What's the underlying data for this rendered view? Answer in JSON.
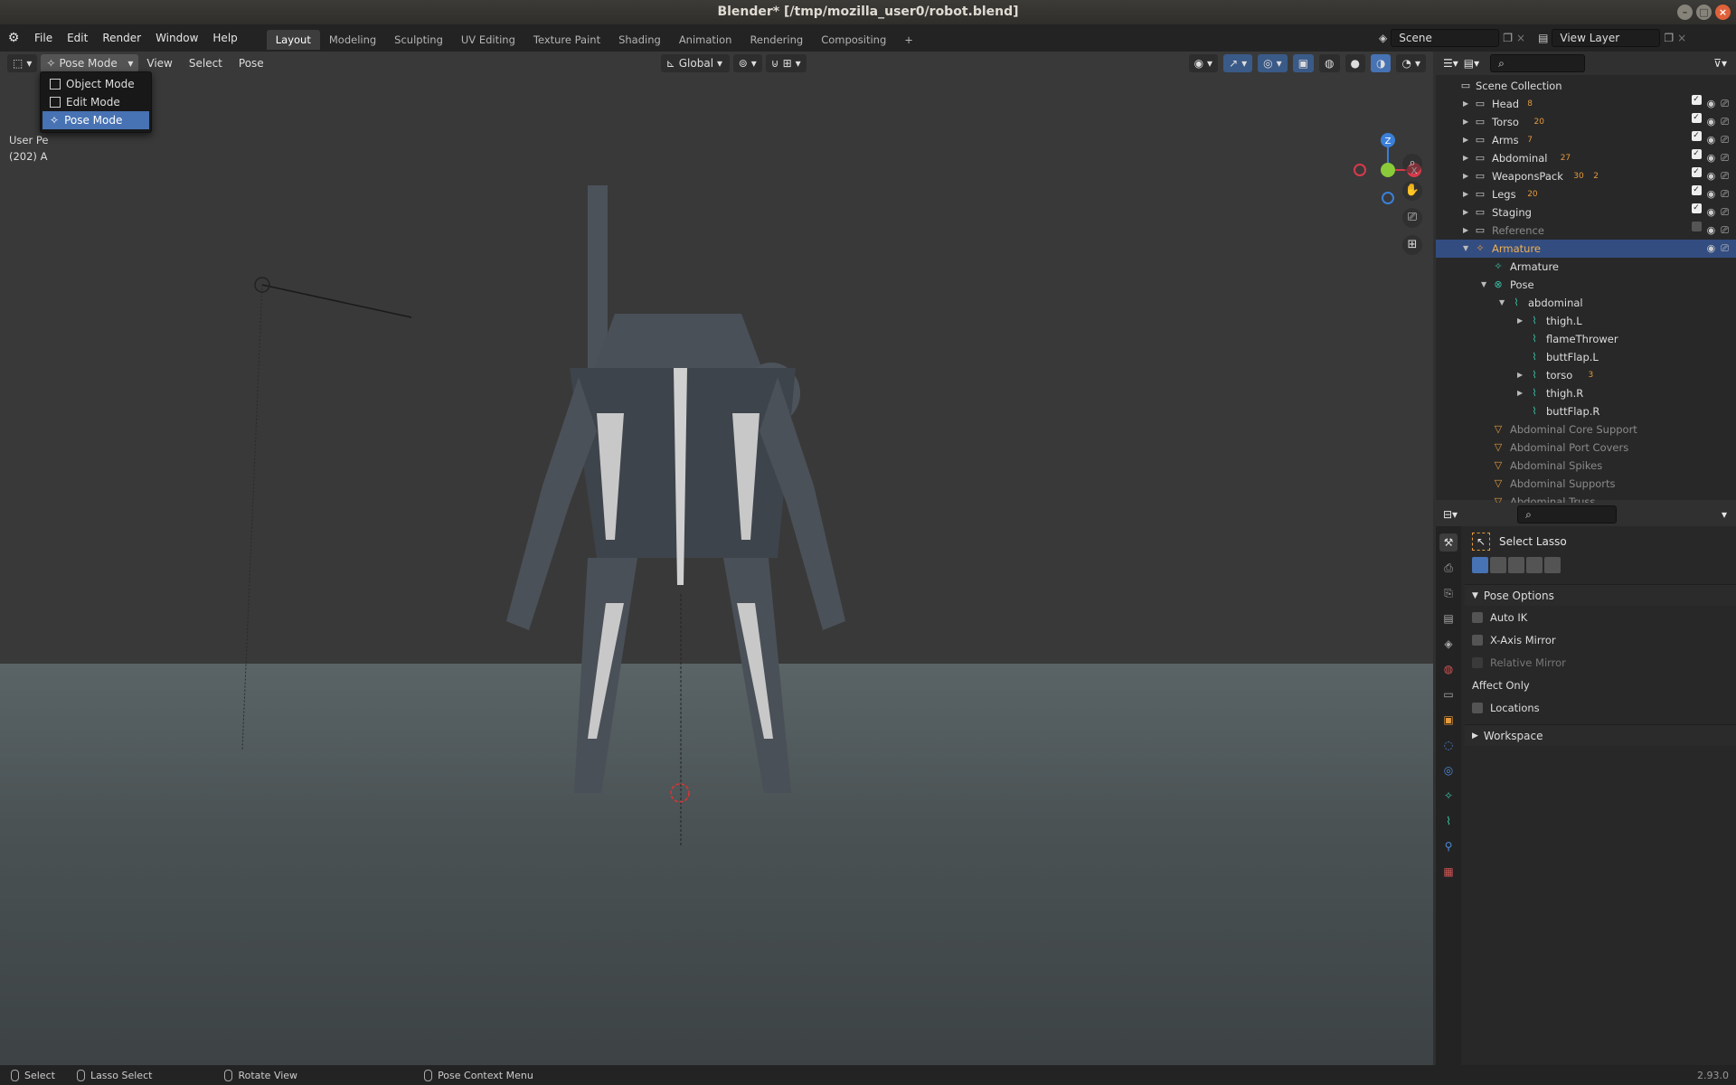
{
  "window": {
    "title": "Blender* [/tmp/mozilla_user0/robot.blend]"
  },
  "top_menu": [
    "File",
    "Edit",
    "Render",
    "Window",
    "Help"
  ],
  "workspaces": [
    "Layout",
    "Modeling",
    "Sculpting",
    "UV Editing",
    "Texture Paint",
    "Shading",
    "Animation",
    "Rendering",
    "Compositing"
  ],
  "active_workspace": "Layout",
  "scene": {
    "name": "Scene",
    "view_layer": "View Layer"
  },
  "viewport": {
    "mode_label": "Pose Mode",
    "menus": [
      "View",
      "Select",
      "Pose"
    ],
    "transform_orientation": "Global",
    "info_line1": "User Pe",
    "info_line2": "(202) A",
    "mode_dropdown": [
      "Object Mode",
      "Edit Mode",
      "Pose Mode"
    ],
    "selected_mode": "Pose Mode",
    "gizmo_axes": {
      "z": "Z",
      "y": "Y",
      "x": "X"
    }
  },
  "outliner": {
    "root": "Scene Collection",
    "rows": [
      {
        "label": "Head",
        "badge": "8",
        "dim": false,
        "selected": false
      },
      {
        "label": "Torso",
        "badge": "20",
        "dim": false,
        "selected": false
      },
      {
        "label": "Arms",
        "badge": "7",
        "dim": false,
        "selected": false
      },
      {
        "label": "Abdominal",
        "badge": "27",
        "dim": false,
        "selected": false
      },
      {
        "label": "WeaponsPack",
        "badge": "30",
        "badge2": "2",
        "dim": false,
        "selected": false
      },
      {
        "label": "Legs",
        "badge": "20",
        "dim": false,
        "selected": false
      },
      {
        "label": "Staging",
        "badge": "",
        "dim": false,
        "selected": false
      },
      {
        "label": "Reference",
        "badge": "",
        "dim": true,
        "selected": false
      },
      {
        "label": "Armature",
        "badge": "",
        "dim": false,
        "selected": true
      },
      {
        "label": "Armature",
        "badge": "",
        "dim": false,
        "selected": false
      },
      {
        "label": "Pose",
        "badge": "",
        "dim": false,
        "selected": false
      },
      {
        "label": "abdominal",
        "badge": "",
        "dim": false,
        "selected": false
      },
      {
        "label": "thigh.L",
        "badge": "",
        "dim": false,
        "selected": false
      },
      {
        "label": "flameThrower",
        "badge": "",
        "dim": false,
        "selected": false
      },
      {
        "label": "buttFlap.L",
        "badge": "",
        "dim": false,
        "selected": false
      },
      {
        "label": "torso",
        "badge": "3",
        "dim": false,
        "selected": false
      },
      {
        "label": "thigh.R",
        "badge": "",
        "dim": false,
        "selected": false
      },
      {
        "label": "buttFlap.R",
        "badge": "",
        "dim": false,
        "selected": false
      },
      {
        "label": "Abdominal Core Support",
        "badge": "",
        "dim": true,
        "selected": false
      },
      {
        "label": "Abdominal Port Covers",
        "badge": "",
        "dim": true,
        "selected": false
      },
      {
        "label": "Abdominal Spikes",
        "badge": "",
        "dim": true,
        "selected": false
      },
      {
        "label": "Abdominal Supports",
        "badge": "",
        "dim": true,
        "selected": false
      },
      {
        "label": "Abdominal Truss",
        "badge": "",
        "dim": true,
        "selected": false
      }
    ]
  },
  "properties": {
    "tool_name": "Select Lasso",
    "section_pose_options": "Pose Options",
    "auto_ik": "Auto IK",
    "x_axis_mirror": "X-Axis Mirror",
    "relative_mirror": "Relative Mirror",
    "affect_only": "Affect Only",
    "locations": "Locations",
    "section_workspace": "Workspace"
  },
  "statusbar": {
    "select": "Select",
    "lasso_select": "Lasso Select",
    "rotate_view": "Rotate View",
    "pose_context_menu": "Pose Context Menu",
    "version": "2.93.0"
  },
  "colors": {
    "accent": "#4772b3",
    "selected_row": "#334d80",
    "object_orange": "#e59a3b",
    "bone_teal": "#3ac2a5"
  }
}
